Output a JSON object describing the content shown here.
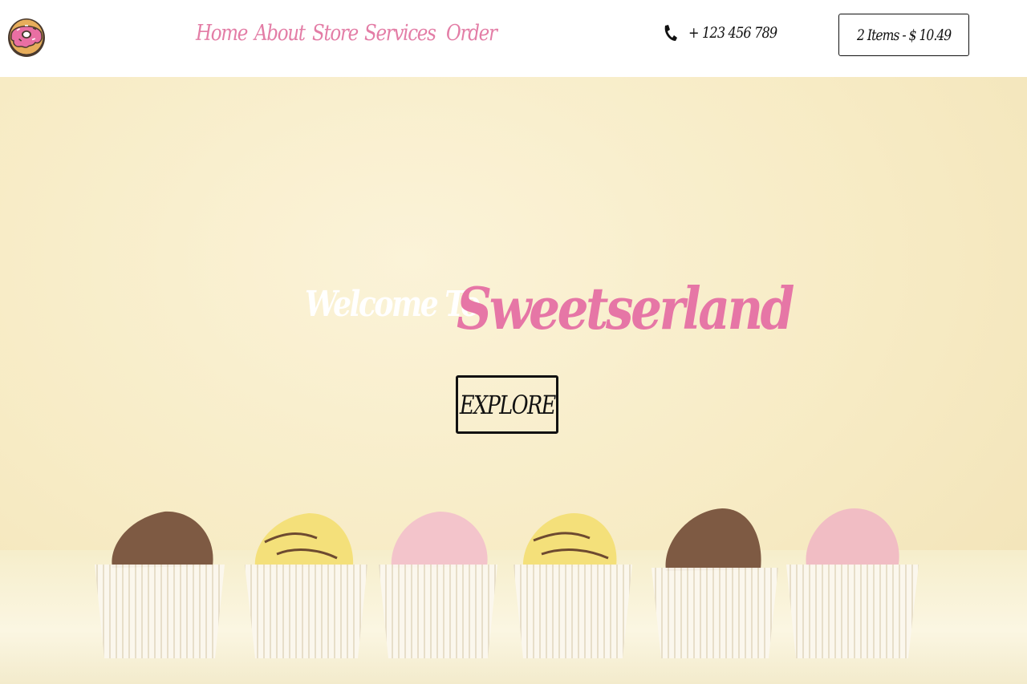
{
  "nav": {
    "items": [
      {
        "label": "Home"
      },
      {
        "label": "About"
      },
      {
        "label": "Store"
      },
      {
        "label": "Services"
      },
      {
        "label": "Order"
      }
    ]
  },
  "contact": {
    "phone": "+ 123 456 789"
  },
  "cart": {
    "label": "2 Items - $ 10.49"
  },
  "hero": {
    "welcome": "Welcome To",
    "brand": "Sweetserland",
    "button": "EXPLORE"
  },
  "colors": {
    "accent": "#e676a6",
    "text": "#111111",
    "hero_bg": "#f7ebc4"
  },
  "icons": {
    "logo": "donut-icon",
    "phone": "phone-icon",
    "cart": "cart-icon"
  }
}
